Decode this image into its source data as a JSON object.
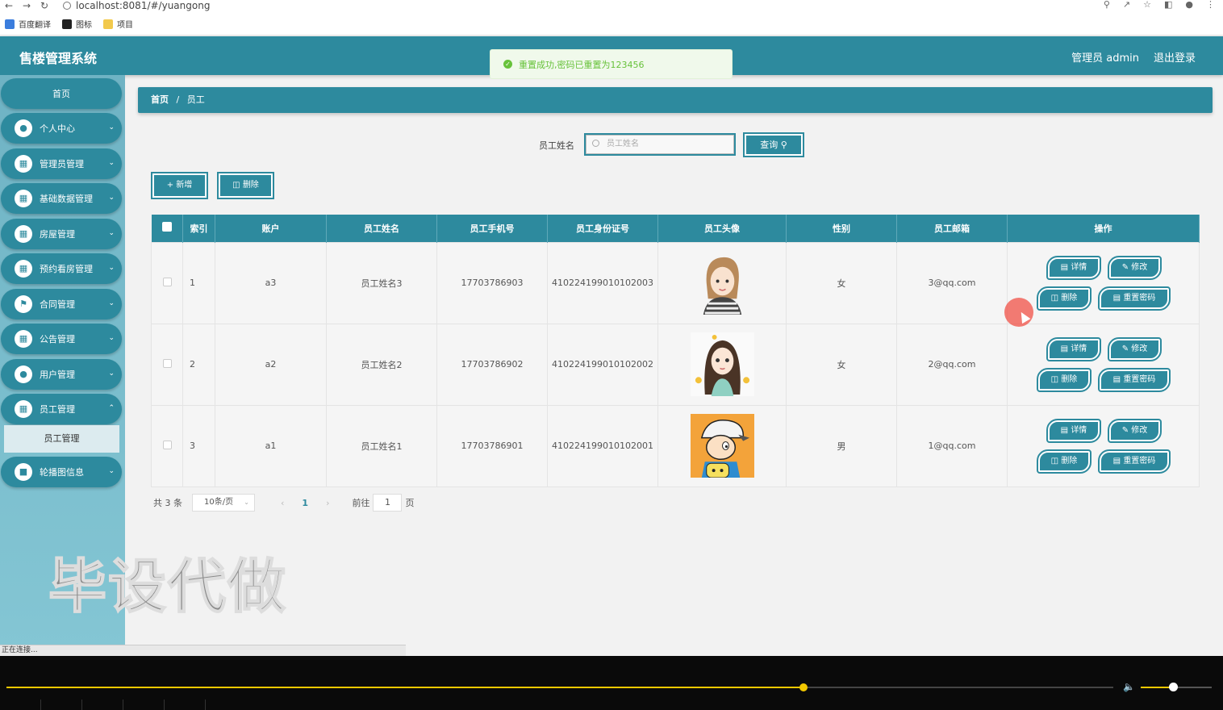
{
  "browser": {
    "url": "localhost:8081/#/yuangong",
    "bookmarks": [
      "百度翻译",
      "图标",
      "项目"
    ],
    "status": "正在连接..."
  },
  "header": {
    "title": "售楼管理系统",
    "user": "管理员 admin",
    "logout": "退出登录"
  },
  "toast": {
    "message": "重置成功,密码已重置为123456",
    "color": "#67c23a"
  },
  "sidebar": {
    "home": "首页",
    "items": [
      {
        "label": "个人中心",
        "icon": "user-icon"
      },
      {
        "label": "管理员管理",
        "icon": "clipboard-icon"
      },
      {
        "label": "基础数据管理",
        "icon": "grid-icon"
      },
      {
        "label": "房屋管理",
        "icon": "grid-icon"
      },
      {
        "label": "预约看房管理",
        "icon": "grid-icon"
      },
      {
        "label": "合同管理",
        "icon": "flag-icon"
      },
      {
        "label": "公告管理",
        "icon": "grid-icon"
      },
      {
        "label": "用户管理",
        "icon": "user-icon"
      },
      {
        "label": "员工管理",
        "icon": "grid-icon"
      },
      {
        "label": "轮播图信息",
        "icon": "monitor-icon"
      }
    ],
    "submenu": "员工管理",
    "watermark": "毕设代做"
  },
  "breadcrumb": {
    "home": "首页",
    "sep": "/",
    "current": "员工"
  },
  "search": {
    "label": "员工姓名",
    "placeholder": "员工姓名",
    "button": "查询"
  },
  "actions": {
    "add": "+ 新增",
    "delete": "删除"
  },
  "table": {
    "headers": [
      "索引",
      "账户",
      "员工姓名",
      "员工手机号",
      "员工身份证号",
      "员工头像",
      "性别",
      "员工邮箱",
      "操作"
    ],
    "rows": [
      {
        "index": "1",
        "account": "a3",
        "name": "员工姓名3",
        "phone": "17703786903",
        "idcard": "410224199010102003",
        "gender": "女",
        "email": "3@qq.com"
      },
      {
        "index": "2",
        "account": "a2",
        "name": "员工姓名2",
        "phone": "17703786902",
        "idcard": "410224199010102002",
        "gender": "女",
        "email": "2@qq.com"
      },
      {
        "index": "3",
        "account": "a1",
        "name": "员工姓名1",
        "phone": "17703786901",
        "idcard": "410224199010102001",
        "gender": "男",
        "email": "1@qq.com"
      }
    ],
    "ops": {
      "detail": "详情",
      "edit": "修改",
      "delete": "删除",
      "reset": "重置密码"
    }
  },
  "pager": {
    "total": "共 3 条",
    "page_size": "10条/页",
    "current": "1",
    "goto_label": "前往",
    "goto_value": "1",
    "page_suffix": "页"
  },
  "player": {
    "progress": 0.72,
    "volume": 0.45
  },
  "colors": {
    "primary": "#2d8a9e",
    "sidebar": "#6fb3c4"
  }
}
